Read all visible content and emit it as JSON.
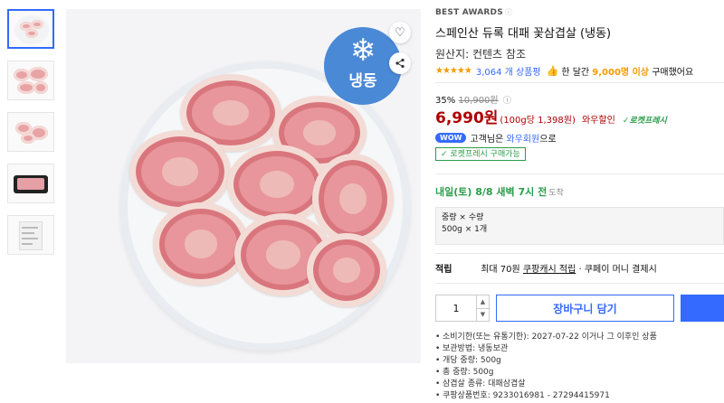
{
  "thumbnails": [
    "thumb-1",
    "thumb-2",
    "thumb-3",
    "thumb-4",
    "thumb-5"
  ],
  "badge": {
    "icon": "snowflake-icon",
    "text": "냉동"
  },
  "product": {
    "awards": "BEST AWARDS",
    "awards_info": "ⓘ",
    "title": "스페인산 듀록 대패 꽃삼겹살 (냉동)",
    "origin": "원산지: 컨텐츠 참조",
    "stars": "★★★★★",
    "rating_count": "3,064 개 상품평",
    "buyers_prefix": "한 달간",
    "buyers_count": "9,000명 이상",
    "buyers_suffix": "구매했어요"
  },
  "price": {
    "discount_pct": "35%",
    "original": "10,900원",
    "info_icon": "ⓘ",
    "sale": "6,990원",
    "unit": "(100g당 1,398원)",
    "wow": "와우할인",
    "rocket": "✓로켓프레시",
    "accent": "#ae0000"
  },
  "wow": {
    "badge": "WOW",
    "text_before": "고객님은",
    "link": "와우회원",
    "text_after": "으로"
  },
  "rocket_button": "✓ 로켓프레시 구매가능",
  "delivery": {
    "text": "내일(토) 8/8 새벽 7시 전",
    "place": "도착"
  },
  "option": {
    "header": "중량 × 수량",
    "value": "500g × 1개"
  },
  "reward": {
    "label": "적립",
    "prefix": "최대 70원",
    "link": "쿠팡캐시 적립",
    "suffix": "· 쿠페이 머니 결제시"
  },
  "buy": {
    "quantity": "1",
    "cart_label": "장바구니 담기",
    "brand_color": "#346aff"
  },
  "details": [
    "소비기한(또는 유통기한): 2027-07-22 이거나 그 이후인 상품",
    "보관방법: 냉동보관",
    "개당 중량: 500g",
    "총 중량: 500g",
    "삼겹살 종류: 대패삼겹살",
    "쿠팡상품번호: 9233016981 - 27294415971"
  ]
}
